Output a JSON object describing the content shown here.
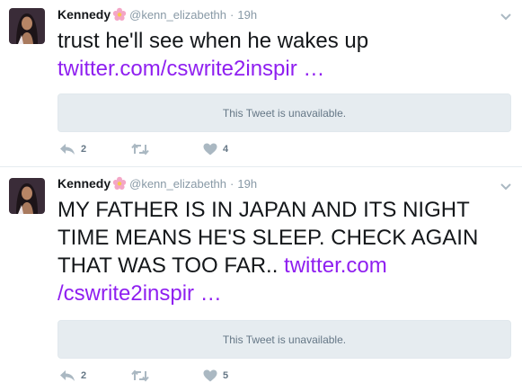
{
  "tweets": [
    {
      "name": "Kennedy",
      "emoji": "flower-emoji",
      "handle": "@kenn_elizabethh",
      "separator": "·",
      "time": "19h",
      "text": "trust he'll see when he wakes up ",
      "link": "twitter.com/cswrite2inspir …",
      "unavailable": "This Tweet is unavailable.",
      "reply_count": "2",
      "retweet_count": "",
      "like_count": "4"
    },
    {
      "name": "Kennedy",
      "emoji": "flower-emoji",
      "handle": "@kenn_elizabethh",
      "separator": "·",
      "time": "19h",
      "text": "MY FATHER IS IN JAPAN AND ITS NIGHT TIME MEANS HE'S SLEEP. CHECK AGAIN THAT WAS TOO FAR.. ",
      "link": "twitter.com /cswrite2inspir …",
      "unavailable": "This Tweet is unavailable.",
      "reply_count": "2",
      "retweet_count": "",
      "like_count": "5"
    }
  ],
  "colors": {
    "link": "#8f1ff0",
    "muted": "#8899a6",
    "icon": "#aab8c2",
    "card_bg": "#e6ecf0"
  }
}
